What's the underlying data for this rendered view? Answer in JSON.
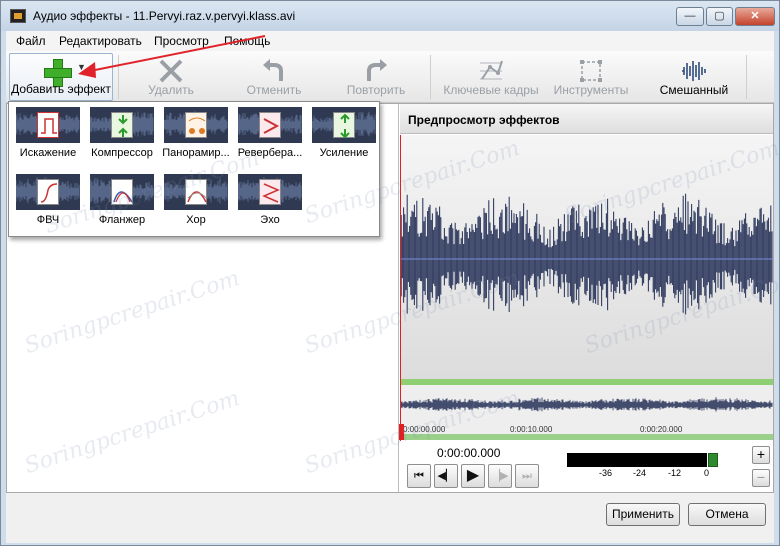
{
  "window": {
    "title": "Аудио эффекты - 11.Pervyi.raz.v.pervyi.klass.avi",
    "min": "—",
    "max": "▢",
    "close": "✕"
  },
  "menu": [
    "Файл",
    "Редактировать",
    "Просмотр",
    "Помощь"
  ],
  "toolbar": {
    "add": "Добавить эффект",
    "delete": "Удалить",
    "undo": "Отменить",
    "redo": "Повторить",
    "keyframes": "Ключевые кадры",
    "tools": "Инструменты",
    "mixed": "Смешанный"
  },
  "effects": [
    "Искажение",
    "Компрессор",
    "Панорамир...",
    "Реверберa...",
    "Усиление",
    "ФВЧ",
    "Фланжер",
    "Хор",
    "Эхо"
  ],
  "preview": {
    "title": "Предпросмотр эффектов",
    "timecode": "0:00:00.000",
    "ruler": [
      "0:00:00.000",
      "0:00:10.000",
      "0:00:20.000"
    ]
  },
  "meter": {
    "ticks": [
      "-36",
      "-24",
      "-12",
      "0"
    ]
  },
  "zoom": {
    "in": "+",
    "out": "−"
  },
  "buttons": {
    "apply": "Применить",
    "cancel": "Отмена"
  },
  "watermark": "Soringpcrepair.Com",
  "colors": {
    "wave": "#2f3a5e",
    "accent_green": "#3fae2a",
    "arrow": "#e0222b"
  }
}
